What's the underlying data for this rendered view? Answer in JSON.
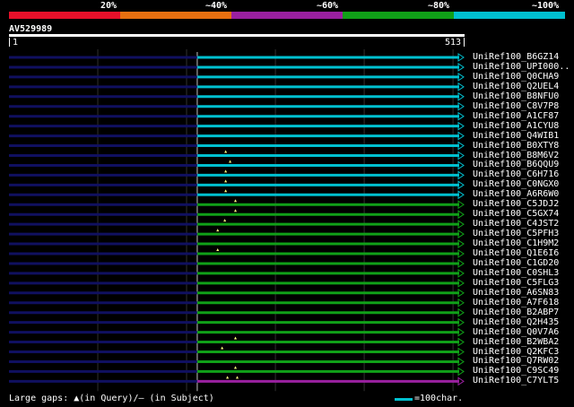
{
  "query": {
    "name": "AV529989",
    "start": "1",
    "end": "513",
    "length": 513
  },
  "legend": {
    "segments": [
      {
        "color": "#e8102a",
        "label": ""
      },
      {
        "color": "#e87010",
        "label": "20%"
      },
      {
        "color": "#9a20a0",
        "label": "~40%"
      },
      {
        "color": "#10a018",
        "label": "~60%"
      },
      {
        "color": "#00c0d0",
        "label": "~80%"
      }
    ],
    "end_label": "~100%"
  },
  "colors": {
    "cyan": "#00c0d0",
    "green": "#10a018",
    "purple": "#9a20a0",
    "dark_blue": "#101060",
    "grid": "#303030",
    "gap_marker": "#ffff80"
  },
  "hits": [
    {
      "id": "UniRef100_B6GZ14",
      "color": "cyan",
      "start": 213,
      "end": 513,
      "gaps": []
    },
    {
      "id": "UniRef100_UPI000..",
      "color": "cyan",
      "start": 213,
      "end": 513,
      "gaps": []
    },
    {
      "id": "UniRef100_Q0CHA9",
      "color": "cyan",
      "start": 213,
      "end": 513,
      "gaps": []
    },
    {
      "id": "UniRef100_Q2UEL4",
      "color": "cyan",
      "start": 213,
      "end": 513,
      "gaps": []
    },
    {
      "id": "UniRef100_B8NFU0",
      "color": "cyan",
      "start": 213,
      "end": 513,
      "gaps": []
    },
    {
      "id": "UniRef100_C8V7P8",
      "color": "cyan",
      "start": 213,
      "end": 513,
      "gaps": []
    },
    {
      "id": "UniRef100_A1CF87",
      "color": "cyan",
      "start": 213,
      "end": 513,
      "gaps": []
    },
    {
      "id": "UniRef100_A1CYU8",
      "color": "cyan",
      "start": 213,
      "end": 513,
      "gaps": []
    },
    {
      "id": "UniRef100_Q4WIB1",
      "color": "cyan",
      "start": 213,
      "end": 513,
      "gaps": []
    },
    {
      "id": "UniRef100_B0XTY8",
      "color": "cyan",
      "start": 213,
      "end": 513,
      "gaps": []
    },
    {
      "id": "UniRef100_B8M6V2",
      "color": "cyan",
      "start": 213,
      "end": 513,
      "gaps": [
        245
      ]
    },
    {
      "id": "UniRef100_B6QQU9",
      "color": "cyan",
      "start": 213,
      "end": 513,
      "gaps": [
        250
      ]
    },
    {
      "id": "UniRef100_C6H716",
      "color": "cyan",
      "start": 213,
      "end": 513,
      "gaps": [
        245
      ]
    },
    {
      "id": "UniRef100_C0NGX0",
      "color": "cyan",
      "start": 213,
      "end": 513,
      "gaps": [
        245
      ]
    },
    {
      "id": "UniRef100_A6R6W0",
      "color": "cyan",
      "start": 213,
      "end": 513,
      "gaps": [
        245
      ]
    },
    {
      "id": "UniRef100_C5JDJ2",
      "color": "green",
      "start": 213,
      "end": 513,
      "gaps": [
        256
      ]
    },
    {
      "id": "UniRef100_C5GX74",
      "color": "green",
      "start": 213,
      "end": 513,
      "gaps": [
        256
      ]
    },
    {
      "id": "UniRef100_C4JST2",
      "color": "green",
      "start": 213,
      "end": 513,
      "gaps": [
        244
      ]
    },
    {
      "id": "UniRef100_C5PFH3",
      "color": "green",
      "start": 213,
      "end": 513,
      "gaps": [
        236
      ]
    },
    {
      "id": "UniRef100_C1H9M2",
      "color": "green",
      "start": 213,
      "end": 513,
      "gaps": []
    },
    {
      "id": "UniRef100_Q1E6I6",
      "color": "green",
      "start": 213,
      "end": 513,
      "gaps": [
        236
      ]
    },
    {
      "id": "UniRef100_C1GD20",
      "color": "green",
      "start": 213,
      "end": 513,
      "gaps": []
    },
    {
      "id": "UniRef100_C0SHL3",
      "color": "green",
      "start": 213,
      "end": 513,
      "gaps": []
    },
    {
      "id": "UniRef100_C5FLG3",
      "color": "green",
      "start": 213,
      "end": 513,
      "gaps": []
    },
    {
      "id": "UniRef100_A6SN83",
      "color": "green",
      "start": 213,
      "end": 513,
      "gaps": []
    },
    {
      "id": "UniRef100_A7F618",
      "color": "green",
      "start": 213,
      "end": 513,
      "gaps": []
    },
    {
      "id": "UniRef100_B2ABP7",
      "color": "green",
      "start": 213,
      "end": 513,
      "gaps": []
    },
    {
      "id": "UniRef100_Q2H435",
      "color": "green",
      "start": 213,
      "end": 513,
      "gaps": []
    },
    {
      "id": "UniRef100_Q0V7A6",
      "color": "green",
      "start": 213,
      "end": 513,
      "gaps": []
    },
    {
      "id": "UniRef100_B2WBA2",
      "color": "green",
      "start": 213,
      "end": 513,
      "gaps": [
        256
      ]
    },
    {
      "id": "UniRef100_Q2KFC3",
      "color": "green",
      "start": 213,
      "end": 513,
      "gaps": [
        241
      ]
    },
    {
      "id": "UniRef100_Q7RW02",
      "color": "green",
      "start": 213,
      "end": 513,
      "gaps": []
    },
    {
      "id": "UniRef100_C9SC49",
      "color": "green",
      "start": 213,
      "end": 513,
      "gaps": [
        256
      ]
    },
    {
      "id": "UniRef100_C7YLT5",
      "color": "purple",
      "start": 213,
      "end": 513,
      "gaps": [
        247,
        258
      ]
    }
  ],
  "footer": {
    "gaps_label": "Large gaps: ▲(in Query)/– (in Subject)",
    "scale_label": "=100char."
  }
}
